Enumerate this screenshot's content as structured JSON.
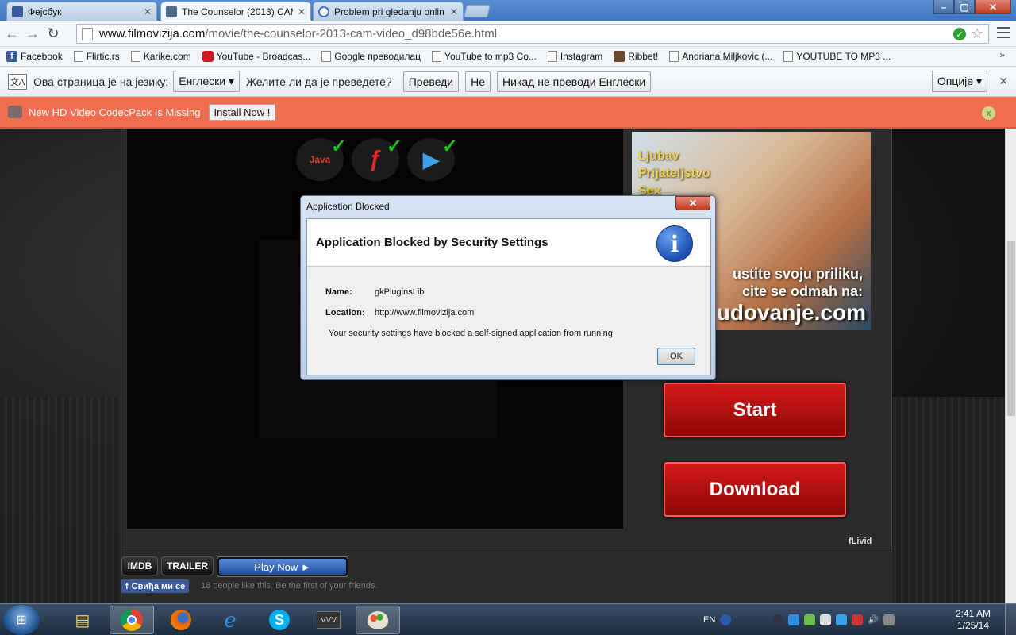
{
  "tabs": [
    {
      "title": "Фејсбук",
      "icon_color": "#3b5998"
    },
    {
      "title": "The Counselor (2013) CAM",
      "icon_color": "#4d6b8f"
    },
    {
      "title": "Problem pri gledanju onlin",
      "icon_color": "#3a6fd1"
    }
  ],
  "window_controls": {
    "minimize": "–",
    "maximize": "▢",
    "close": "✕"
  },
  "address_bar": {
    "host": "www.filmovizija.com",
    "path": "/movie/the-counselor-2013-cam-video_d98bde56e.html"
  },
  "bookmarks": [
    {
      "label": "Facebook",
      "icon": "facebook-icon"
    },
    {
      "label": "Flirtic.rs",
      "icon": "page-icon"
    },
    {
      "label": "Karike.com",
      "icon": "page-icon"
    },
    {
      "label": "YouTube - Broadcas...",
      "icon": "youtube-icon"
    },
    {
      "label": "Google преводилац",
      "icon": "page-icon"
    },
    {
      "label": "YouTube to mp3 Co...",
      "icon": "page-icon"
    },
    {
      "label": "Instagram",
      "icon": "page-icon"
    },
    {
      "label": "Ribbet!",
      "icon": "ribbet-icon"
    },
    {
      "label": "Andriana Miljkovic (...",
      "icon": "page-icon"
    },
    {
      "label": "YOUTUBE TO MP3 ...",
      "icon": "page-icon"
    }
  ],
  "bookmarks_more": "»",
  "translate_bar": {
    "prefix": "Ова страница је на језику:",
    "language": "Енглески",
    "question": "Желите ли да је преведете?",
    "translate": "Преведи",
    "no": "Не",
    "never": "Никад не преводи Енглески",
    "options": "Опције"
  },
  "codec_bar": {
    "message": "New HD Video CodecPack Is Missing",
    "install": "Install Now !",
    "close": "x"
  },
  "player": {
    "plugins": [
      "Java",
      "",
      ""
    ]
  },
  "ad": {
    "line1": "Ljubav",
    "line2": "Prijateljstvo",
    "line3": "Sex",
    "line4": "ustite svoju priliku,",
    "line5": "cite se odmah na:",
    "domain": "udovanje.com"
  },
  "buttons": {
    "start": "Start",
    "download": "Download"
  },
  "flivid": "fLivid",
  "below_player": {
    "imdb": "IMDB",
    "trailer": "TRAILER",
    "play_now": "Play Now ►",
    "fb_like": "Свиђа ми се",
    "fb_text": "18 people like this. Be the first of your friends."
  },
  "dialog": {
    "window_title": "Application Blocked",
    "heading": "Application Blocked by Security Settings",
    "name_label": "Name:",
    "name_value": "gkPluginsLib",
    "location_label": "Location:",
    "location_value": "http://www.filmovizija.com",
    "message": "Your security settings have blocked a self-signed application from running",
    "ok": "OK"
  },
  "taskbar": {
    "language": "EN",
    "time": "2:41 AM",
    "date": "1/25/14"
  }
}
